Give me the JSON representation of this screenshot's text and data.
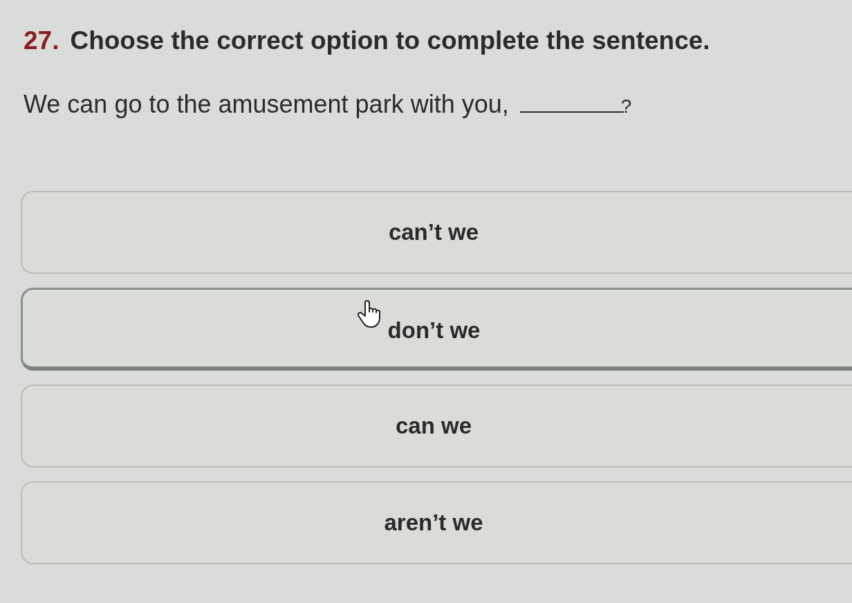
{
  "question": {
    "number": "27.",
    "prompt": "Choose the correct option to complete the sentence.",
    "sentence_before": "We can go to the amusement park with you,",
    "sentence_after": "?"
  },
  "options": [
    {
      "label": "can’t we",
      "hovered": false
    },
    {
      "label": "don’t we",
      "hovered": true
    },
    {
      "label": "can we",
      "hovered": false
    },
    {
      "label": "aren’t we",
      "hovered": false
    }
  ]
}
